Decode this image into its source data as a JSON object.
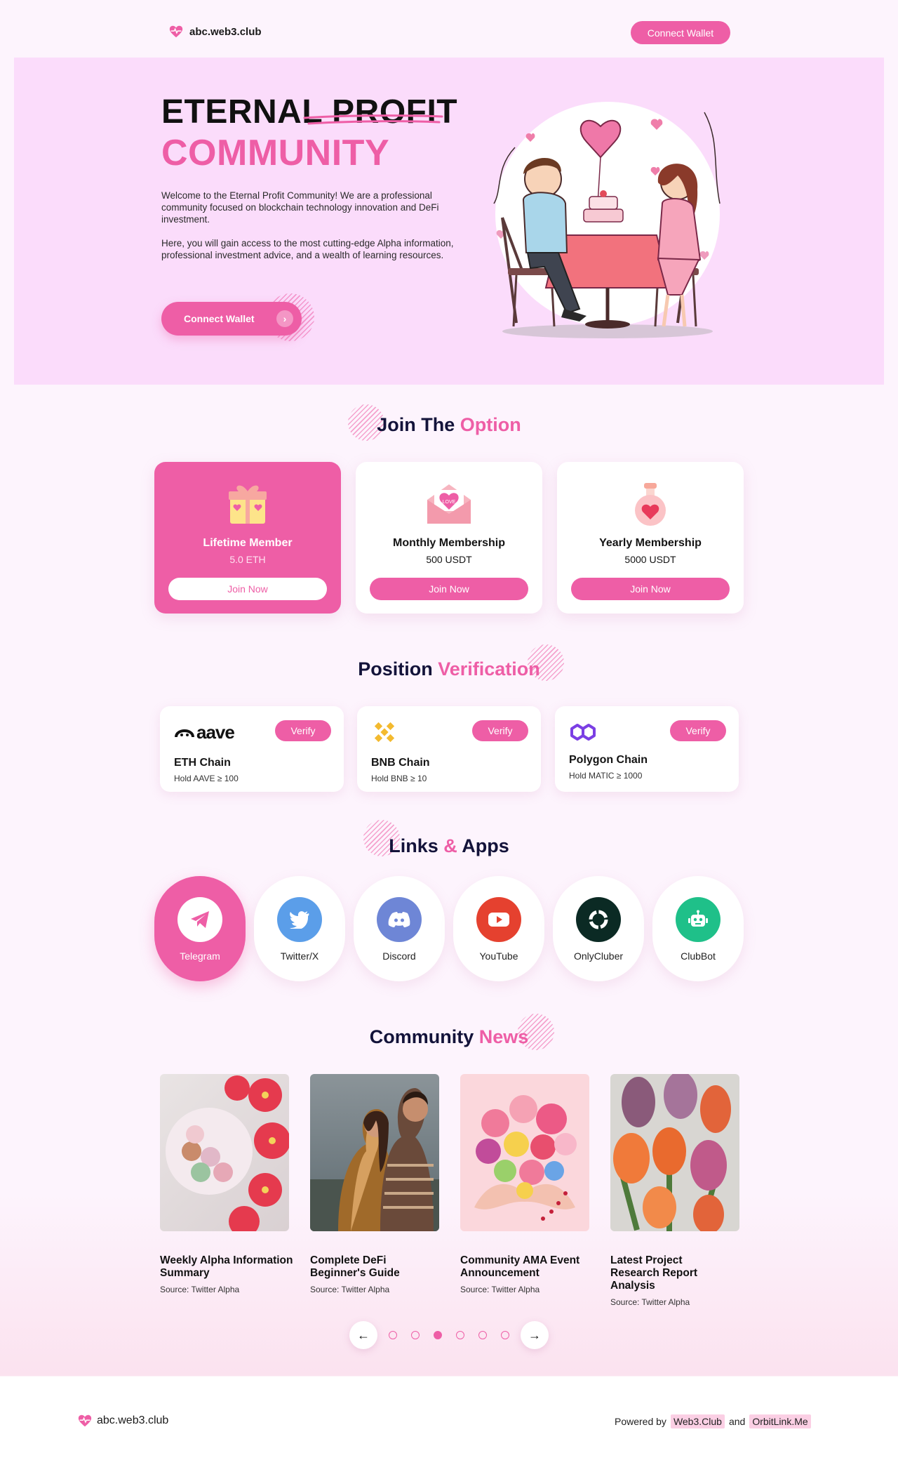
{
  "header": {
    "brand": "abc.web3.club",
    "connect_label": "Connect Wallet"
  },
  "hero": {
    "title_line1": "ETERNAL PROFIT",
    "title_line2": "COMMUNITY",
    "paragraph1": "Welcome to the Eternal Profit Community! We are a professional community focused on blockchain technology innovation and DeFi investment.",
    "paragraph2": "Here, you will gain access to the most cutting-edge Alpha information, professional investment advice, and a wealth of learning resources.",
    "cta_label": "Connect Wallet"
  },
  "join": {
    "title_dark": "Join The",
    "title_pink": "Option",
    "cards": [
      {
        "name": "Lifetime Member",
        "price": "5.0 ETH",
        "button": "Join Now",
        "icon": "gift-icon"
      },
      {
        "name": "Monthly Membership",
        "price": "500 USDT",
        "button": "Join Now",
        "icon": "love-letter-icon"
      },
      {
        "name": "Yearly Membership",
        "price": "5000 USDT",
        "button": "Join Now",
        "icon": "potion-heart-icon"
      }
    ]
  },
  "verify": {
    "title_dark": "Position",
    "title_pink": "Verification",
    "cards": [
      {
        "logo_text": "aave",
        "chain": "ETH Chain",
        "hold": "Hold AAVE ≥ 100",
        "button": "Verify",
        "icon": "aave-logo-icon"
      },
      {
        "chain": "BNB Chain",
        "hold": "Hold BNB ≥ 10",
        "button": "Verify",
        "icon": "bnb-logo-icon"
      },
      {
        "chain": "Polygon Chain",
        "hold": "Hold MATIC ≥ 1000",
        "button": "Verify",
        "icon": "polygon-logo-icon"
      }
    ]
  },
  "links": {
    "title_dark1": "Links",
    "title_amp": "&",
    "title_dark2": "Apps",
    "items": [
      {
        "label": "Telegram",
        "icon": "telegram-icon"
      },
      {
        "label": "Twitter/X",
        "icon": "twitter-icon",
        "color": "#5b9ee9"
      },
      {
        "label": "Discord",
        "icon": "discord-icon",
        "color": "#6e86d6"
      },
      {
        "label": "YouTube",
        "icon": "youtube-icon",
        "color": "#e5412f"
      },
      {
        "label": "OnlyCluber",
        "icon": "onlycluber-icon",
        "color": "#0b2a24"
      },
      {
        "label": "ClubBot",
        "icon": "robot-icon",
        "color": "#1fc089"
      }
    ]
  },
  "news": {
    "title_dark": "Community",
    "title_pink": "News",
    "items": [
      {
        "title": "Weekly Alpha Information Summary",
        "source": "Source: Twitter Alpha"
      },
      {
        "title": "Complete DeFi Beginner's Guide",
        "source": "Source: Twitter Alpha"
      },
      {
        "title": "Community AMA Event Announcement",
        "source": "Source: Twitter Alpha"
      },
      {
        "title": "Latest Project Research Report Analysis",
        "source": "Source: Twitter Alpha"
      }
    ],
    "prev": "←",
    "next": "→",
    "active_page": 3,
    "pages": 6
  },
  "footer": {
    "brand": "abc.web3.club",
    "powered_by": "Powered by",
    "link1": "Web3.Club",
    "and": "and",
    "link2": "OrbitLink.Me"
  },
  "colors": {
    "accent": "#ee5ea6",
    "hero_bg": "#fbdcfb",
    "page_bg": "#fdf4fd",
    "heading": "#13133a"
  }
}
